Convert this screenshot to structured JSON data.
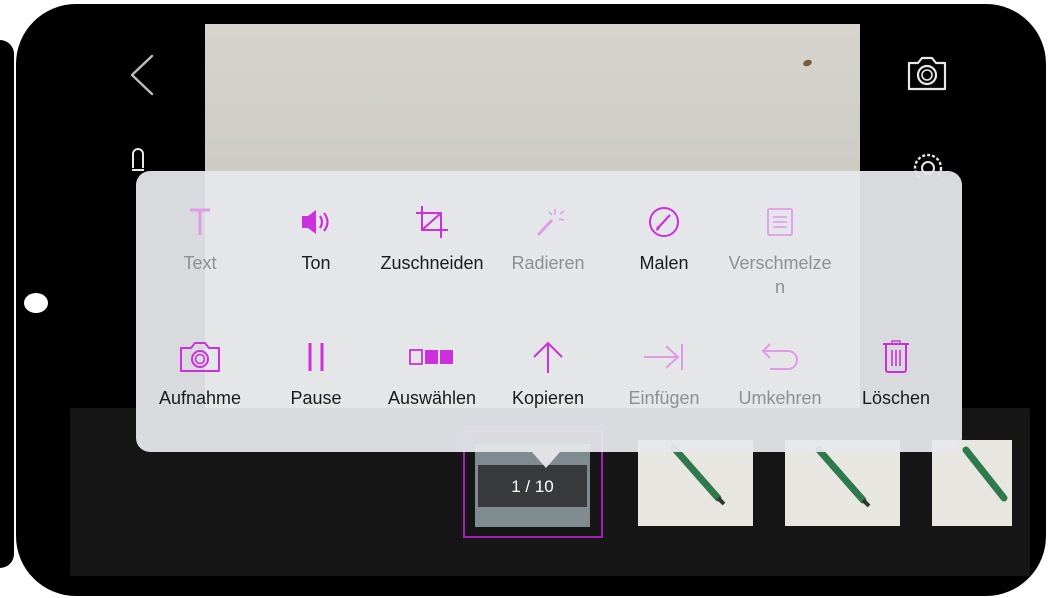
{
  "menu": {
    "row1": [
      {
        "label": "Text",
        "icon": "text-icon",
        "enabled": false
      },
      {
        "label": "Ton",
        "icon": "speaker-icon",
        "enabled": true
      },
      {
        "label": "Zuschneiden",
        "icon": "crop-icon",
        "enabled": true
      },
      {
        "label": "Radieren",
        "icon": "magic-wand-icon",
        "enabled": false
      },
      {
        "label": "Malen",
        "icon": "pencil-circle-icon",
        "enabled": true
      },
      {
        "label": "Verschmelzen",
        "icon": "merge-icon",
        "enabled": false
      }
    ],
    "row2": [
      {
        "label": "Aufnahme",
        "icon": "camera-icon",
        "enabled": true
      },
      {
        "label": "Pause",
        "icon": "pause-icon",
        "enabled": true
      },
      {
        "label": "Auswählen",
        "icon": "select-frames-icon",
        "enabled": true
      },
      {
        "label": "Kopieren",
        "icon": "arrow-up-icon",
        "enabled": true
      },
      {
        "label": "Einfügen",
        "icon": "insert-arrow-icon",
        "enabled": false
      },
      {
        "label": "Umkehren",
        "icon": "undo-icon",
        "enabled": false
      },
      {
        "label": "Löschen",
        "icon": "trash-icon",
        "enabled": true
      }
    ]
  },
  "timeline": {
    "frame_indicator": "1 / 10"
  },
  "colors": {
    "accent": "#cc2fdc",
    "accent_disabled": "#e09be8",
    "selection_border": "#a321b5",
    "label": "#1a1a1a",
    "label_disabled": "#8e8e93",
    "menu_background": "#e7e8eb"
  }
}
